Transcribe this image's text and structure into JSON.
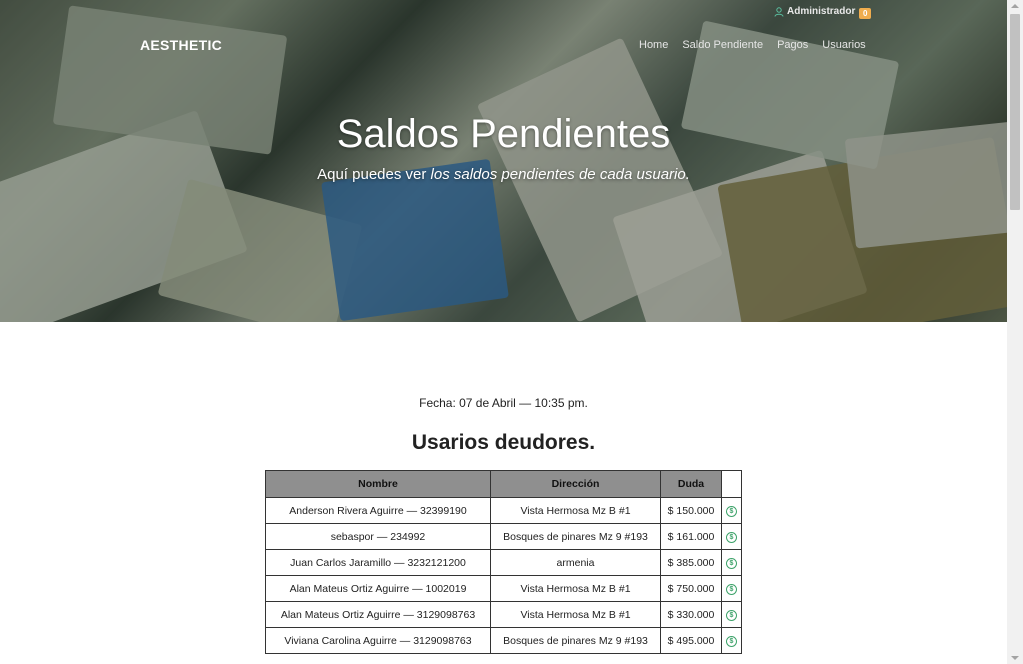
{
  "header": {
    "brand": "AESTHETIC",
    "user": "Administrador",
    "notifications": "0",
    "nav": [
      "Home",
      "Saldo Pendiente",
      "Pagos",
      "Usuarios"
    ]
  },
  "hero": {
    "title": "Saldos Pendientes",
    "subtitle_plain": "Aquí puedes ver ",
    "subtitle_italic": "los saldos pendientes de cada usuario."
  },
  "content": {
    "fecha": "Fecha: 07 de Abril — 10:35 pm.",
    "section_title": "Usarios deudores.",
    "table": {
      "headers": [
        "Nombre",
        "Dirección",
        "Duda",
        ""
      ],
      "rows": [
        [
          "Anderson Rivera Aguirre — 32399190",
          "Vista Hermosa Mz B #1",
          "$ 150.000"
        ],
        [
          "sebaspor — 234992",
          "Bosques de pinares Mz 9 #193",
          "$ 161.000"
        ],
        [
          "Juan Carlos Jaramillo — 3232121200",
          "armenia",
          "$ 385.000"
        ],
        [
          "Alan Mateus Ortiz Aguirre — 1002019",
          "Vista Hermosa Mz B #1",
          "$ 750.000"
        ],
        [
          "Alan Mateus Ortiz Aguirre — 3129098763",
          "Vista Hermosa Mz B #1",
          "$ 330.000"
        ],
        [
          "Viviana Carolina Aguirre — 3129098763",
          "Bosques de pinares Mz 9 #193",
          "$ 495.000"
        ]
      ],
      "row_action_icon": "dollar-circle-icon"
    }
  },
  "colors": {
    "table_header": "#8f8f8f",
    "badge": "#f0ad4e",
    "action_icon": "#3ea36a"
  }
}
